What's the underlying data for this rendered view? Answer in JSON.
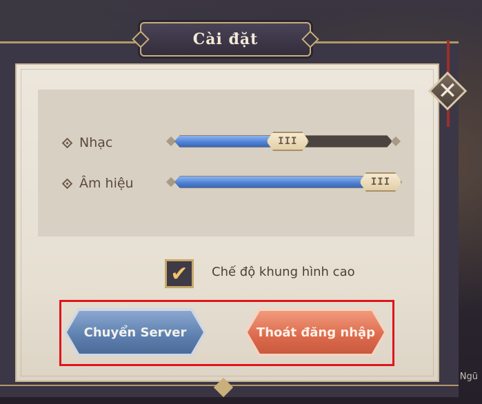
{
  "dialog": {
    "title": "Cài đặt",
    "close_icon": "close-icon"
  },
  "audio": {
    "music": {
      "label": "Nhạc",
      "level": 0.52,
      "handle_glyph": "III"
    },
    "sfx": {
      "label": "Âm hiệu",
      "level": 0.95,
      "handle_glyph": "III"
    }
  },
  "options": {
    "high_frame_rate": {
      "label": "Chế độ khung hình cao",
      "checked": true,
      "check_glyph": "✔"
    }
  },
  "buttons": {
    "change_server": "Chuyển Server",
    "logout": "Thoát đăng nhập"
  },
  "side_text": {
    "bottom_right": "Ngũ"
  },
  "colors": {
    "slider_fill": "#4c7fd4",
    "button_blue": "#5d7fae",
    "button_orange": "#dc6a4c",
    "highlight": "#e0141c"
  }
}
